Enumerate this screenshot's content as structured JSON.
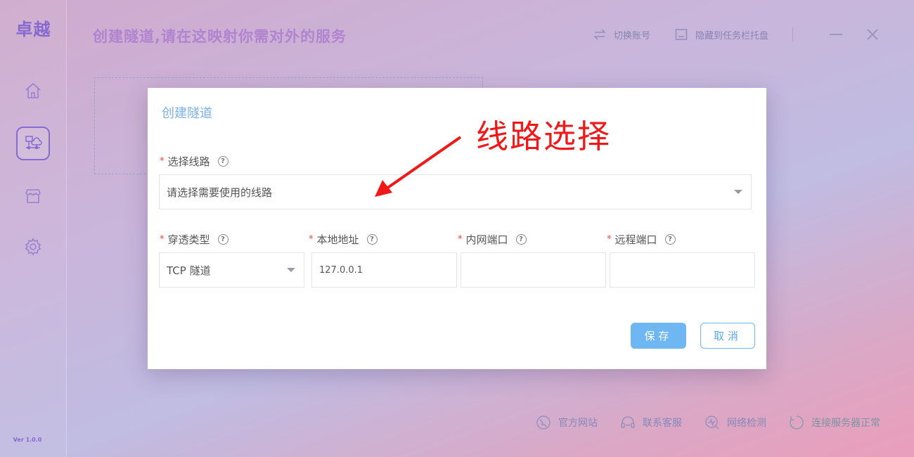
{
  "app": {
    "logo": "卓越",
    "version": "Ver 1.0.0",
    "page_title": "创建隧道,请在这映射你需对外的服务"
  },
  "top_actions": {
    "switch_account": "切换账号",
    "hide_to_tray": "隐藏到任务栏托盘"
  },
  "sidebar": {
    "items": [
      {
        "icon": "home-icon",
        "active": false
      },
      {
        "icon": "tunnel-network-icon",
        "active": true
      },
      {
        "icon": "store-icon",
        "active": false
      },
      {
        "icon": "gear-icon",
        "active": false
      }
    ]
  },
  "footer": {
    "official_site": "官方网站",
    "support": "联系客服",
    "network_check": "网络检测",
    "server_status": "连接服务器正常"
  },
  "dialog": {
    "title": "创建隧道",
    "line_label": "选择线路",
    "line_placeholder": "请选择需要使用的线路",
    "type_label": "穿透类型",
    "type_value": "TCP 隧道",
    "local_addr_label": "本地地址",
    "local_addr_value": "127.0.0.1",
    "internal_port_label": "内网端口",
    "internal_port_value": "",
    "remote_port_label": "远程端口",
    "remote_port_value": "",
    "required_mark": "*",
    "help_glyph": "?",
    "save_label": "保存",
    "cancel_label": "取消"
  },
  "annotation": {
    "text": "线路选择",
    "color": "#f01818"
  },
  "colors": {
    "accent": "#6fb7f3",
    "brand": "#8a6cd8"
  }
}
